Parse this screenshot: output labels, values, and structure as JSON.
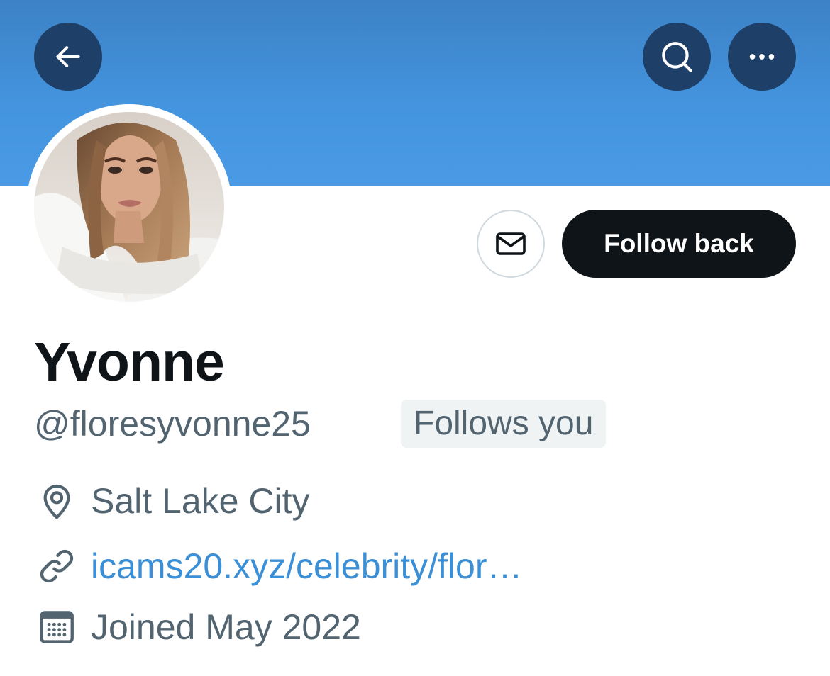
{
  "header": {
    "back_icon": "arrow-left-icon",
    "search_icon": "search-icon",
    "more_icon": "more-horizontal-icon",
    "banner_color": "#4495e0"
  },
  "profile": {
    "name": "Yvonne",
    "handle": "@floresyvonne25",
    "follows_you": "Follows you",
    "follow_back_label": "Follow back",
    "message_icon": "envelope-icon",
    "location": "Salt Lake City",
    "url": "icams20.xyz/celebrity/flor…",
    "joined": "Joined May 2022"
  },
  "colors": {
    "primary_text": "#0f1419",
    "secondary_text": "#536471",
    "link": "#3b8fd6",
    "button_dark": "#0f1419"
  }
}
